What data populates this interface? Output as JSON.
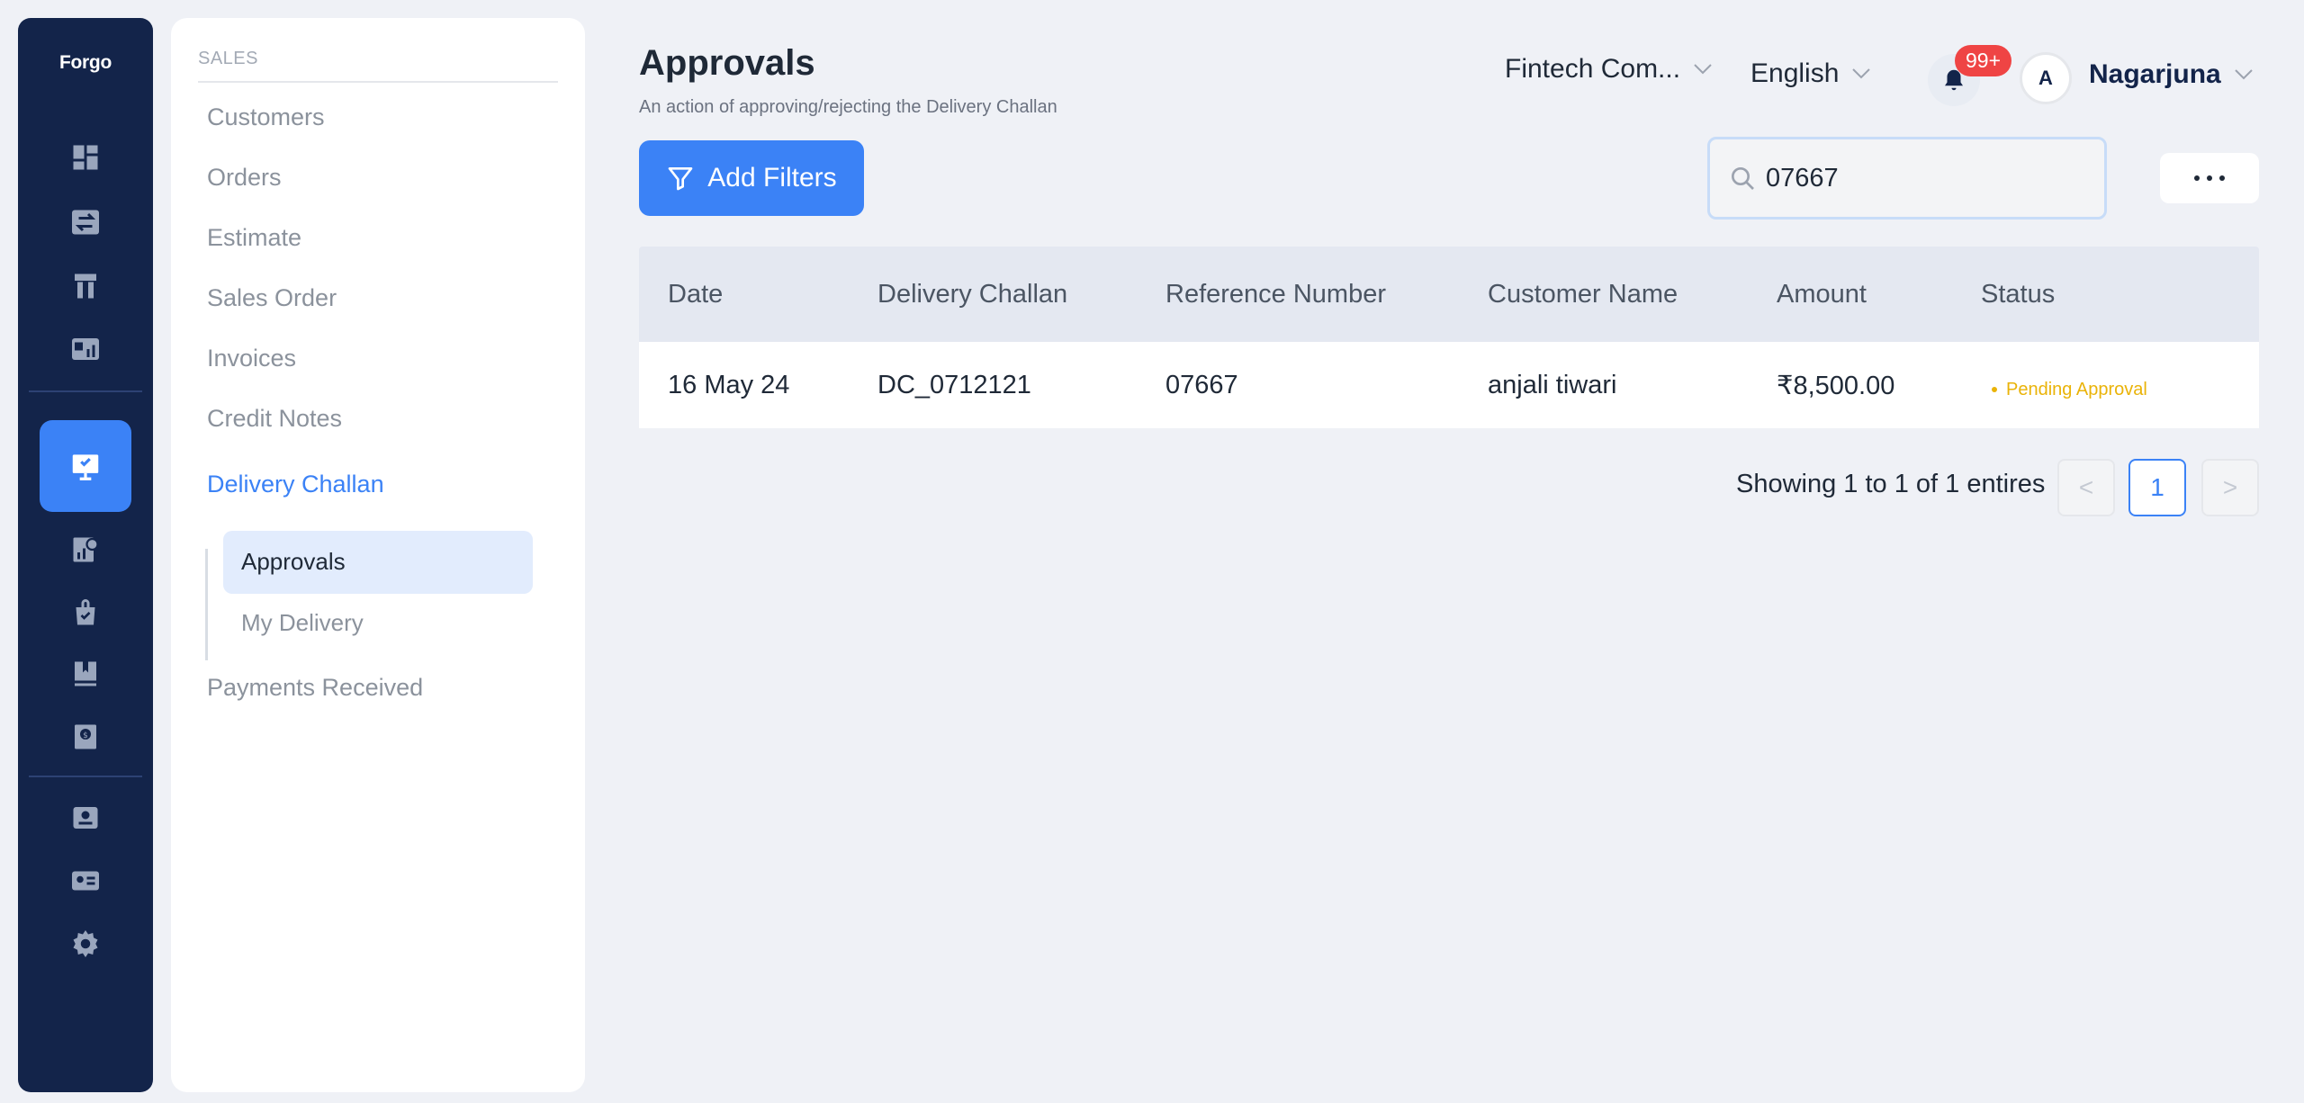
{
  "brand": {
    "logo_text": "Forgo"
  },
  "menu": {
    "section": "SALES",
    "items": [
      {
        "label": "Customers"
      },
      {
        "label": "Orders"
      },
      {
        "label": "Estimate"
      },
      {
        "label": "Sales Order"
      },
      {
        "label": "Invoices"
      },
      {
        "label": "Credit Notes"
      },
      {
        "label": "Delivery Challan"
      },
      {
        "label": "Payments Received"
      }
    ],
    "sub_items": [
      {
        "label": "Approvals"
      },
      {
        "label": "My Delivery"
      }
    ]
  },
  "header": {
    "title": "Approvals",
    "subtitle": "An action of approving/rejecting the Delivery Challan",
    "company": "Fintech Com...",
    "language": "English",
    "notifications_badge": "99+",
    "avatar_initial": "A",
    "user_name": "Nagarjuna"
  },
  "toolbar": {
    "filters_label": "Add Filters",
    "search_value": "07667"
  },
  "table": {
    "columns": [
      "Date",
      "Delivery Challan",
      "Reference Number",
      "Customer Name",
      "Amount",
      "Status"
    ],
    "rows": [
      {
        "date": "16 May 24",
        "challan": "DC_0712121",
        "reference": "07667",
        "customer": "anjali tiwari",
        "amount": "₹8,500.00",
        "status": "Pending Approval"
      }
    ]
  },
  "pagination": {
    "summary": "Showing 1 to 1 of 1 entires",
    "prev": "<",
    "current": "1",
    "next": ">"
  },
  "colors": {
    "rail_bg": "#13244a",
    "accent": "#3b82f6",
    "status_pending": "#eab308",
    "badge": "#ef4444"
  },
  "icons": {
    "rail": [
      "dashboard-icon",
      "transfer-icon",
      "inventory-icon",
      "reports-icon",
      "sales-icon",
      "purchase-analytics-icon",
      "purchase-bag-icon",
      "bookmark-icon",
      "tax-icon",
      "contacts-icon",
      "id-card-icon",
      "settings-icon"
    ]
  }
}
